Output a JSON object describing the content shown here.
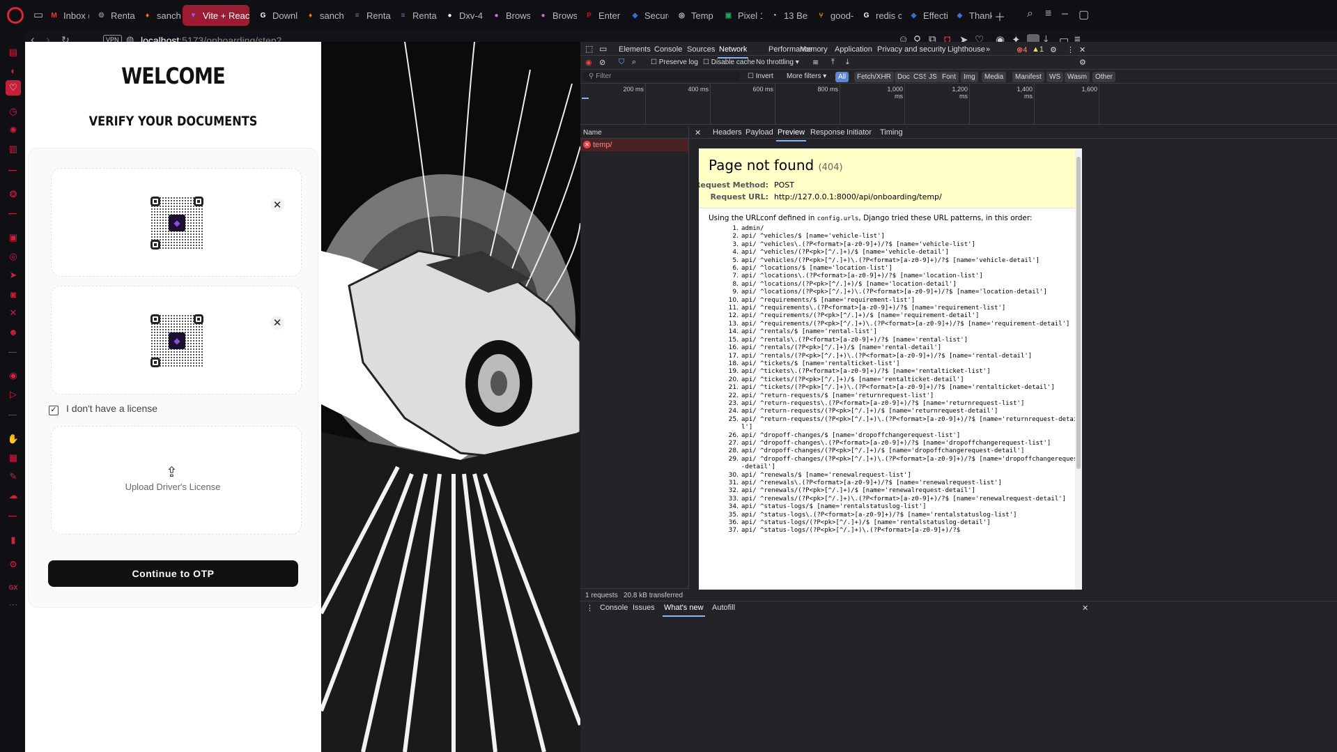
{
  "browser": {
    "tabs": [
      {
        "label": "Inbox (",
        "icon": "gmail-icon",
        "color": "#d44638",
        "glyph": "M"
      },
      {
        "label": "Rentav",
        "icon": "settings-icon",
        "color": "#888888",
        "glyph": "⚙"
      },
      {
        "label": "sancha",
        "icon": "fire-icon",
        "color": "#ff7a00",
        "glyph": "♦"
      },
      {
        "label": "Vite + React",
        "icon": "vite-icon",
        "color": "#9b59f5",
        "glyph": "▼",
        "active": true
      },
      {
        "label": "Downl",
        "icon": "google-icon",
        "color": "#ffffff",
        "glyph": "G"
      },
      {
        "label": "sancha",
        "icon": "fire-icon",
        "color": "#ff7a00",
        "glyph": "♦"
      },
      {
        "label": "Rentav",
        "icon": "docs-icon",
        "color": "#4285f4",
        "glyph": "≡"
      },
      {
        "label": "Rentav",
        "icon": "docs-icon",
        "color": "#4285f4",
        "glyph": "≡"
      },
      {
        "label": "Dxv-4",
        "icon": "github-icon",
        "color": "#ffffff",
        "glyph": "●"
      },
      {
        "label": "Brows",
        "icon": "bubble-icon",
        "color": "#d86fcf",
        "glyph": "●"
      },
      {
        "label": "Brows",
        "icon": "bubble-icon",
        "color": "#d86fcf",
        "glyph": "●"
      },
      {
        "label": "Enter t",
        "icon": "pinterest-icon",
        "color": "#e60023",
        "glyph": "P"
      },
      {
        "label": "Secure",
        "icon": "shield-icon",
        "color": "#3b6fd6",
        "glyph": "◆"
      },
      {
        "label": "Temp",
        "icon": "chrome-icon",
        "color": "#dddddd",
        "glyph": "◎"
      },
      {
        "label": "Pixel 1",
        "icon": "sheet-icon",
        "color": "#1fa463",
        "glyph": "▣"
      },
      {
        "label": "13 Bes",
        "icon": "globe-icon",
        "color": "#ffffff",
        "glyph": "◔"
      },
      {
        "label": "good-",
        "icon": "graph-icon",
        "color": "#f5a623",
        "glyph": "⑂"
      },
      {
        "label": "redis c",
        "icon": "google-icon",
        "color": "#ffffff",
        "glyph": "G"
      },
      {
        "label": "Effecti",
        "icon": "arrow-icon",
        "color": "#3b6fd6",
        "glyph": "◆"
      },
      {
        "label": "Thank",
        "icon": "arrow-icon",
        "color": "#3b6fd6",
        "glyph": "◆"
      }
    ],
    "url_host": "localhost",
    "url_path": ":5173/onboarding/step2",
    "vpn_label": "VPN"
  },
  "app": {
    "welcome": "WELCOME",
    "subtitle": "VERIFY YOUR DOCUMENTS",
    "checkbox_label": "I don't have a license",
    "checkbox_checked": true,
    "upload_label": "Upload Driver's License",
    "continue_button": "Continue to OTP"
  },
  "devtools": {
    "tabs": [
      "Elements",
      "Console",
      "Sources",
      "Network",
      "Performance",
      "Memory",
      "Application",
      "Privacy and security",
      "Lighthouse"
    ],
    "active_tab": "Network",
    "errors": "4",
    "warnings": "1",
    "preserve_log": "Preserve log",
    "disable_cache": "Disable cache",
    "throttling": "No throttling",
    "filter_placeholder": "Filter",
    "invert": "Invert",
    "more_filters": "More filters",
    "filter_types": [
      "All",
      "Fetch/XHR",
      "Doc",
      "CSS",
      "JS",
      "Font",
      "Img",
      "Media",
      "Manifest",
      "WS",
      "Wasm",
      "Other"
    ],
    "timeline_ticks": [
      "200 ms",
      "400 ms",
      "600 ms",
      "800 ms",
      "1,000 ms",
      "1,200 ms",
      "1,400 ms",
      "1,600"
    ],
    "name_header": "Name",
    "request_name": "temp/",
    "detail_tabs": [
      "Headers",
      "Payload",
      "Preview",
      "Response",
      "Initiator",
      "Timing"
    ],
    "active_detail_tab": "Preview",
    "status_requests": "1 requests",
    "status_transferred": "20.8 kB transferred",
    "drawer_tabs": [
      "Console",
      "Issues",
      "What's new",
      "Autofill"
    ],
    "preview": {
      "title": "Page not found",
      "code": "(404)",
      "method_label": "Request Method:",
      "method": "POST",
      "url_label": "Request URL:",
      "url": "http://127.0.0.1:8000/api/onboarding/temp/",
      "intro_before": "Using the URLconf defined in ",
      "intro_code": "config.urls",
      "intro_after": ", Django tried these URL patterns, in this order:",
      "patterns": [
        "admin/",
        "api/ ^vehicles/$ [name='vehicle-list']",
        "api/ ^vehicles\\.(?P<format>[a-z0-9]+)/?$ [name='vehicle-list']",
        "api/ ^vehicles/(?P<pk>[^/.]+)/$ [name='vehicle-detail']",
        "api/ ^vehicles/(?P<pk>[^/.]+)\\.(?P<format>[a-z0-9]+)/?$ [name='vehicle-detail']",
        "api/ ^locations/$ [name='location-list']",
        "api/ ^locations\\.(?P<format>[a-z0-9]+)/?$ [name='location-list']",
        "api/ ^locations/(?P<pk>[^/.]+)/$ [name='location-detail']",
        "api/ ^locations/(?P<pk>[^/.]+)\\.(?P<format>[a-z0-9]+)/?$ [name='location-detail']",
        "api/ ^requirements/$ [name='requirement-list']",
        "api/ ^requirements\\.(?P<format>[a-z0-9]+)/?$ [name='requirement-list']",
        "api/ ^requirements/(?P<pk>[^/.]+)/$ [name='requirement-detail']",
        "api/ ^requirements/(?P<pk>[^/.]+)\\.(?P<format>[a-z0-9]+)/?$ [name='requirement-detail']",
        "api/ ^rentals/$ [name='rental-list']",
        "api/ ^rentals\\.(?P<format>[a-z0-9]+)/?$ [name='rental-list']",
        "api/ ^rentals/(?P<pk>[^/.]+)/$ [name='rental-detail']",
        "api/ ^rentals/(?P<pk>[^/.]+)\\.(?P<format>[a-z0-9]+)/?$ [name='rental-detail']",
        "api/ ^tickets/$ [name='rentalticket-list']",
        "api/ ^tickets\\.(?P<format>[a-z0-9]+)/?$ [name='rentalticket-list']",
        "api/ ^tickets/(?P<pk>[^/.]+)/$ [name='rentalticket-detail']",
        "api/ ^tickets/(?P<pk>[^/.]+)\\.(?P<format>[a-z0-9]+)/?$ [name='rentalticket-detail']",
        "api/ ^return-requests/$ [name='returnrequest-list']",
        "api/ ^return-requests\\.(?P<format>[a-z0-9]+)/?$ [name='returnrequest-list']",
        "api/ ^return-requests/(?P<pk>[^/.]+)/$ [name='returnrequest-detail']",
        "api/ ^return-requests/(?P<pk>[^/.]+)\\.(?P<format>[a-z0-9]+)/?$ [name='returnrequest-detail']",
        "api/ ^dropoff-changes/$ [name='dropoffchangerequest-list']",
        "api/ ^dropoff-changes\\.(?P<format>[a-z0-9]+)/?$ [name='dropoffchangerequest-list']",
        "api/ ^dropoff-changes/(?P<pk>[^/.]+)/$ [name='dropoffchangerequest-detail']",
        "api/ ^dropoff-changes/(?P<pk>[^/.]+)\\.(?P<format>[a-z0-9]+)/?$ [name='dropoffchangerequest-detail']",
        "api/ ^renewals/$ [name='renewalrequest-list']",
        "api/ ^renewals\\.(?P<format>[a-z0-9]+)/?$ [name='renewalrequest-list']",
        "api/ ^renewals/(?P<pk>[^/.]+)/$ [name='renewalrequest-detail']",
        "api/ ^renewals/(?P<pk>[^/.]+)\\.(?P<format>[a-z0-9]+)/?$ [name='renewalrequest-detail']",
        "api/ ^status-logs/$ [name='rentalstatuslog-list']",
        "api/ ^status-logs\\.(?P<format>[a-z0-9]+)/?$ [name='rentalstatuslog-list']",
        "api/ ^status-logs/(?P<pk>[^/.]+)/$ [name='rentalstatuslog-detail']",
        "api/ ^status-logs/(?P<pk>[^/.]+)\\.(?P<format>[a-z0-9]+)/?$"
      ]
    }
  },
  "colors": {
    "accent": "#c4203a",
    "devtools_bg": "#242428",
    "selected_filter": "#5b85d9"
  }
}
